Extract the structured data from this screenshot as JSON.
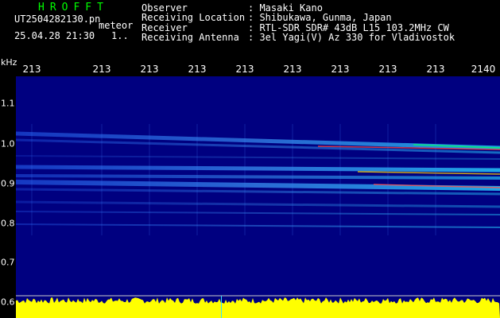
{
  "header": {
    "app_title": "HROFFT",
    "filename": "UT2504282130.pn",
    "category": "meteor",
    "datetime": "25.04.28 21:30",
    "counter": "1..",
    "metadata": [
      {
        "label": "Observer",
        "value": ": Masaki Kano"
      },
      {
        "label": "Receiving Location",
        "value": ": Shibukawa, Gunma, Japan"
      },
      {
        "label": "Receiver",
        "value": ": RTL-SDR SDR# 43dB L15 103.2MHz CW"
      },
      {
        "label": "Receiving Antenna",
        "value": ": 3el Yagi(V) Az 330 for Vladivostok"
      }
    ]
  },
  "axis": {
    "unit_label": "kHz",
    "time_ticks": [
      "213",
      "213",
      "213",
      "213",
      "213",
      "213",
      "213",
      "213",
      "213",
      "2140"
    ],
    "freq_ticks": [
      "1.1",
      "1.0",
      "0.9",
      "0.8",
      "0.7",
      "0.6"
    ]
  },
  "colors": {
    "background": "#000000",
    "plot_background": "#000080",
    "title": "#00ff00",
    "signal_level": "#ffff00",
    "cursor": "#33e0ff"
  }
}
